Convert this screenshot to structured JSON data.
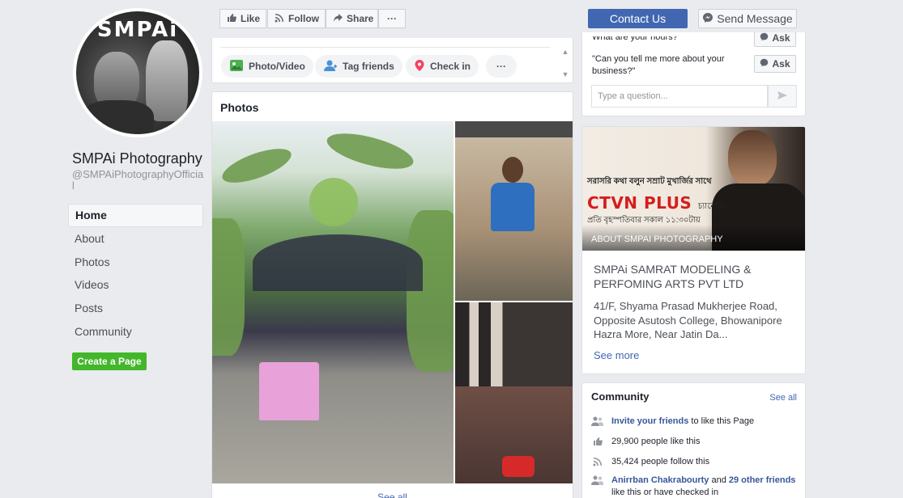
{
  "profile": {
    "avatar_brand": "SMPAi",
    "name": "SMPAi Photography",
    "handle": "@SMPAiPhotographyOfficial"
  },
  "nav": {
    "items": [
      {
        "label": "Home"
      },
      {
        "label": "About"
      },
      {
        "label": "Photos"
      },
      {
        "label": "Videos"
      },
      {
        "label": "Posts"
      },
      {
        "label": "Community"
      }
    ],
    "create_page": "Create a Page"
  },
  "actions": {
    "like": "Like",
    "follow": "Follow",
    "share": "Share",
    "more": "···",
    "contact": "Contact Us",
    "send_message": "Send Message"
  },
  "composer": {
    "photo_video": "Photo/Video",
    "tag_friends": "Tag friends",
    "check_in": "Check in",
    "more": "···"
  },
  "photos": {
    "title": "Photos",
    "see_all": "See all"
  },
  "faq": {
    "q1": "What are your hours?",
    "q2": "\"Can you tell me more about your business?\"",
    "ask_label": "Ask",
    "input_placeholder": "Type a question..."
  },
  "about": {
    "banner_line1": "সরাসরি কথা বলুন সম্রাট মুখার্জির সাথে",
    "banner_brand": "CTVN PLUS",
    "banner_brand_suffix": "চ্যানেলে",
    "banner_line3": "প্রতি বৃহস্পতিবার সকাল ১১:৩০টায়",
    "banner_label": "ABOUT SMPAI PHOTOGRAPHY",
    "company": "SMPAi SAMRAT MODELING & PERFOMING ARTS PVT LTD",
    "address": "41/F, Shyama Prasad Mukherjee Road, Opposite Asutosh College, Bhowanipore Hazra More, Near Jatin Da...",
    "see_more": "See more"
  },
  "community": {
    "title": "Community",
    "see_all": "See all",
    "invite_link": "Invite your friends",
    "invite_rest": " to like this Page",
    "likes": "29,900 people like this",
    "follows": "35,424 people follow this",
    "friend_name": "Anirrban Chakrabourty",
    "friend_and": " and ",
    "friend_others": "29 other friends",
    "friend_rest": " like this or have checked in"
  },
  "colors": {
    "brand_blue": "#4267b2",
    "create_green": "#42b72a",
    "link_blue": "#365899"
  }
}
